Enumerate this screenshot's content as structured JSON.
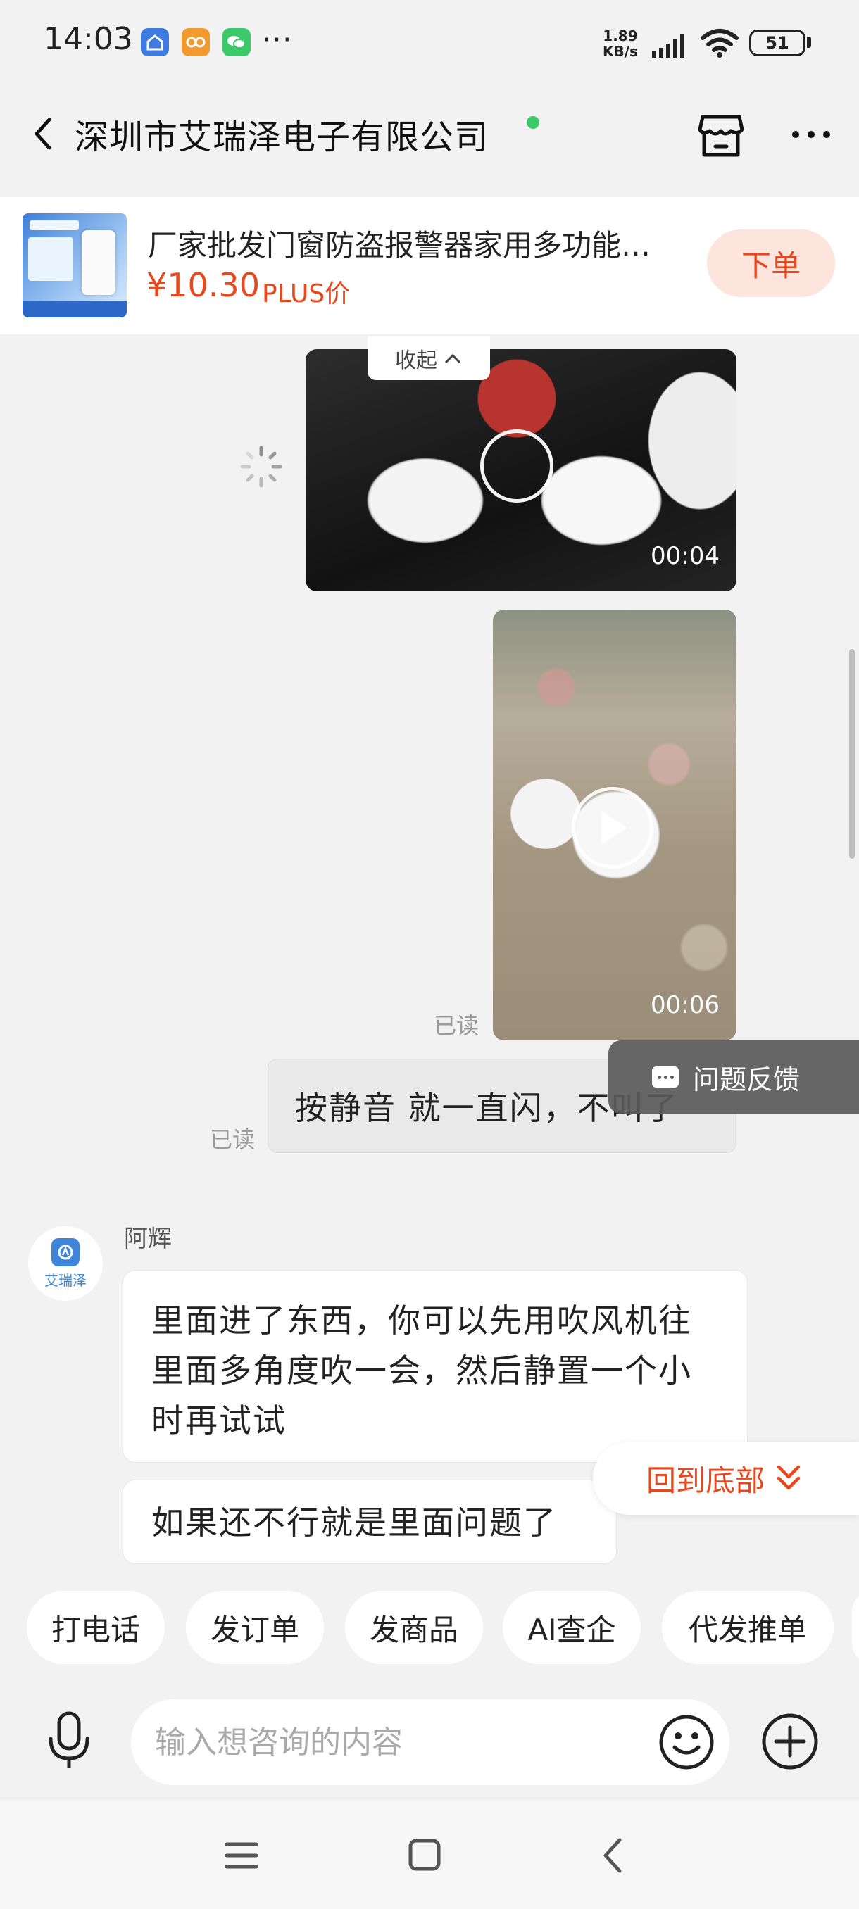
{
  "status_bar": {
    "time": "14:03",
    "more": "···",
    "net_speed_value": "1.89",
    "net_speed_unit": "KB/s",
    "battery": "51",
    "app_icons": [
      "home-app-icon",
      "game-center-icon",
      "wechat-icon"
    ]
  },
  "header": {
    "title": "深圳市艾瑞泽电子有限公司",
    "online": true
  },
  "product": {
    "title": "厂家批发门窗防盗报警器家用多功能…",
    "price": "¥10.30",
    "tag": "PLUS价",
    "order_button": "下单"
  },
  "chat": {
    "collapse_label": "收起",
    "video_1_duration": "00:04",
    "video_2_duration": "00:06",
    "read_label_1": "已读",
    "my_message": "按静音 就一直闪，不叫了",
    "read_label_2": "已读",
    "feedback_button": "问题反馈",
    "agent_avatar_text": "艾瑞泽",
    "agent_name": "阿辉",
    "agent_message_1": "里面进了东西，你可以先用吹风机往里面多角度吹一会，然后静置一个小时再试试",
    "agent_message_2": "如果还不行就是里面问题了",
    "back_to_bottom": "回到底部"
  },
  "quick_actions": [
    "打电话",
    "发订单",
    "发商品",
    "AI查企",
    "代发推单"
  ],
  "input": {
    "placeholder": "输入想咨询的内容"
  },
  "colors": {
    "accent": "#e8481c",
    "online": "#3cc96a",
    "background": "#f2f2f2"
  }
}
